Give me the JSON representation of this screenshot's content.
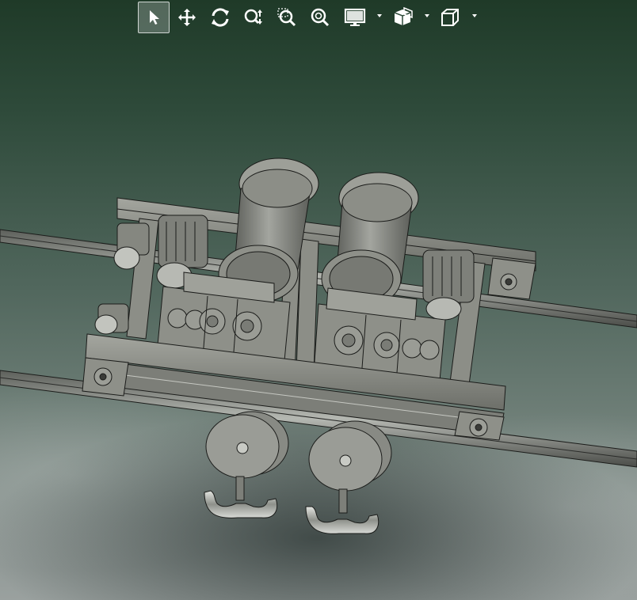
{
  "app": {
    "view": "3d-model-viewport"
  },
  "toolbar": {
    "tools": [
      {
        "id": "select",
        "icon": "select-arrow-icon",
        "active": true
      },
      {
        "id": "pan",
        "icon": "pan-move-icon",
        "active": false
      },
      {
        "id": "rotate",
        "icon": "rotate-icon",
        "active": false
      },
      {
        "id": "zoom-updown",
        "icon": "zoom-updown-icon",
        "active": false
      },
      {
        "id": "zoom-window",
        "icon": "zoom-window-icon",
        "active": false
      },
      {
        "id": "zoom-fit",
        "icon": "zoom-fit-icon",
        "active": false
      },
      {
        "id": "display-style",
        "icon": "display-monitor-icon",
        "dropdown": true
      },
      {
        "id": "section-view",
        "icon": "section-view-icon",
        "dropdown": true
      },
      {
        "id": "view-orientation",
        "icon": "view-cube-icon",
        "dropdown": true
      }
    ]
  },
  "colors": {
    "background_top": "#1f3a28",
    "background_bottom": "#9aa19f",
    "model_fill": "#8e9089",
    "model_edge": "#1b1c1a",
    "icon": "#ffffff"
  }
}
